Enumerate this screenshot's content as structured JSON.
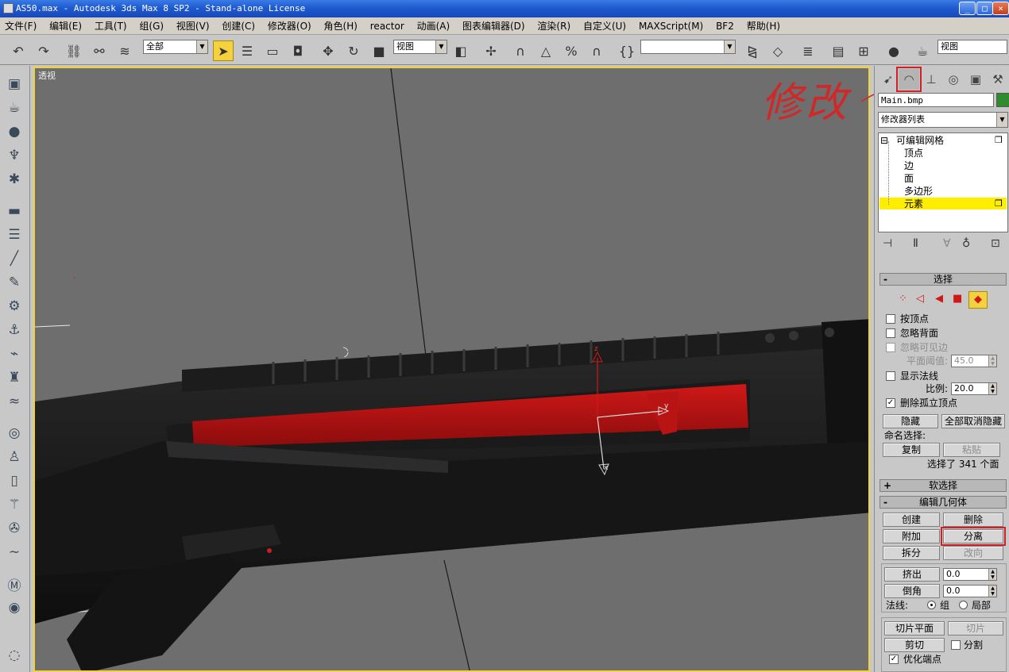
{
  "window": {
    "title": "AS50.max - Autodesk 3ds Max 8 SP2  - Stand-alone License"
  },
  "menu": [
    "文件(F)",
    "编辑(E)",
    "工具(T)",
    "组(G)",
    "视图(V)",
    "创建(C)",
    "修改器(O)",
    "角色(H)",
    "reactor",
    "动画(A)",
    "图表编辑器(D)",
    "渲染(R)",
    "自定义(U)",
    "MAXScript(M)",
    "BF2",
    "帮助(H)"
  ],
  "toolbar": {
    "selection_filter": "全部",
    "ref_coord": "视图",
    "named_sel": "",
    "view_dropdown": "视图"
  },
  "viewport": {
    "label": "透视",
    "axis_z": "z",
    "axis_y": "y",
    "axis_x": "x"
  },
  "annotation": {
    "text": "修改"
  },
  "panel": {
    "object_name": "Main.bmp",
    "object_color": "#2e8b2e",
    "modifier_list": "修改器列表",
    "stack": {
      "root": "可编辑网格",
      "items": [
        "顶点",
        "边",
        "面",
        "多边形",
        "元素"
      ],
      "selected": "元素"
    },
    "selection": {
      "title": "选择",
      "by_vertex": "按顶点",
      "ignore_backface": "忽略背面",
      "ignore_visible_edges": "忽略可见边",
      "planar_thresh_label": "平面阈值:",
      "planar_thresh_value": "45.0",
      "show_normals": "显示法线",
      "scale_label": "比例:",
      "scale_value": "20.0",
      "delete_isolated": "删除孤立顶点",
      "hide": "隐藏",
      "unhide_all": "全部取消隐藏",
      "named_sel": "命名选择:",
      "copy": "复制",
      "paste": "粘贴",
      "status": "选择了 341 个面"
    },
    "soft_selection": {
      "title": "软选择"
    },
    "edit_geometry": {
      "title": "编辑几何体",
      "create": "创建",
      "delete": "删除",
      "attach": "附加",
      "detach": "分离",
      "split": "拆分",
      "turn": "改向",
      "extrude": "挤出",
      "extrude_value": "0.0",
      "chamfer": "倒角",
      "chamfer_value": "0.0",
      "normal_label": "法线:",
      "group": "组",
      "local": "局部",
      "slice_plane": "切片平面",
      "slice": "切片",
      "cut": "剪切",
      "split_chk": "分割",
      "refine_ends": "优化端点"
    }
  },
  "colors": {
    "highlight": "#d2202a",
    "active_tool": "#f3d13f",
    "selection_red": "#b41414"
  }
}
